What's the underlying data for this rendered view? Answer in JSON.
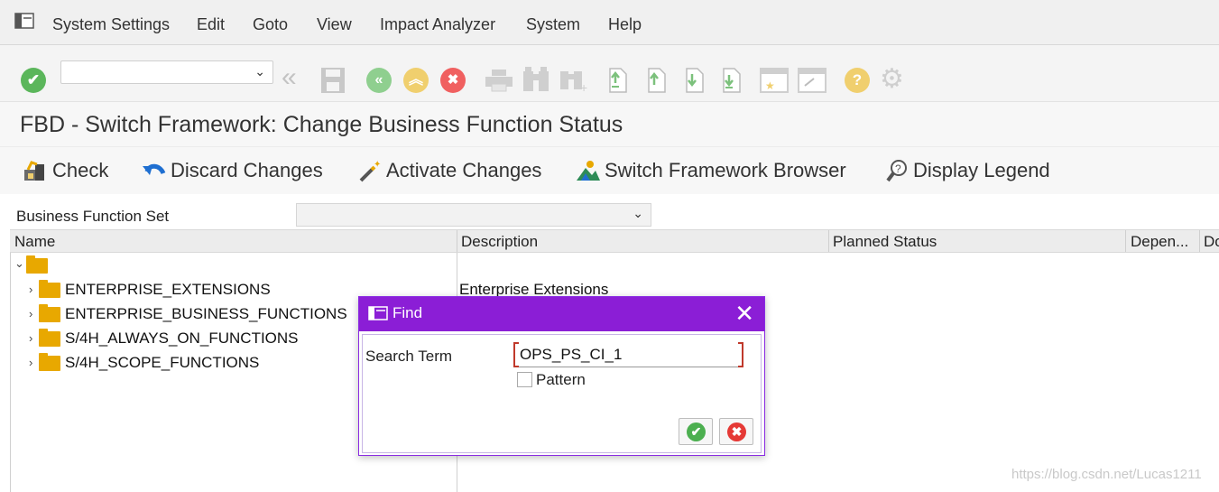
{
  "menu": {
    "items": [
      "System Settings",
      "Edit",
      "Goto",
      "View",
      "Impact Analyzer",
      "System",
      "Help"
    ]
  },
  "toolbar": {
    "command_field_value": "",
    "icons": [
      "enter-icon",
      "back-icon",
      "save-icon",
      "back-nav-icon",
      "exit-icon",
      "cancel-icon",
      "print-icon",
      "find-icon",
      "find-next-icon",
      "first-page-icon",
      "previous-page-icon",
      "next-page-icon",
      "last-page-icon",
      "create-session-icon",
      "shortcut-icon",
      "help-icon",
      "settings-icon"
    ]
  },
  "page": {
    "title": "FBD - Switch Framework: Change Business Function Status"
  },
  "app_toolbar": {
    "check": "Check",
    "discard": "Discard Changes",
    "activate": "Activate Changes",
    "browser": "Switch Framework Browser",
    "legend": "Display Legend"
  },
  "bf_set": {
    "label": "Business Function Set",
    "value": ""
  },
  "table": {
    "columns": [
      "Name",
      "Description",
      "Planned Status",
      "Depen...",
      "Do"
    ],
    "rows": [
      {
        "name": "ENTERPRISE_EXTENSIONS",
        "description": "Enterprise Extensions"
      },
      {
        "name": "ENTERPRISE_BUSINESS_FUNCTIONS",
        "description": ""
      },
      {
        "name": "S/4H_ALWAYS_ON_FUNCTIONS",
        "description": ""
      },
      {
        "name": "S/4H_SCOPE_FUNCTIONS",
        "description": ""
      }
    ]
  },
  "find_dialog": {
    "title": "Find",
    "close": "✕",
    "search_label": "Search Term",
    "search_value": "OPS_PS_CI_1",
    "pattern_label": "Pattern",
    "pattern_checked": false,
    "ok_glyph": "✔",
    "cancel_glyph": "✖"
  },
  "watermark": "https://blog.csdn.net/Lucas1211",
  "colors": {
    "dialog_header": "#8b1ed6",
    "folder": "#e8a800",
    "ok_green": "#4caf50",
    "cancel_red": "#e53935"
  }
}
